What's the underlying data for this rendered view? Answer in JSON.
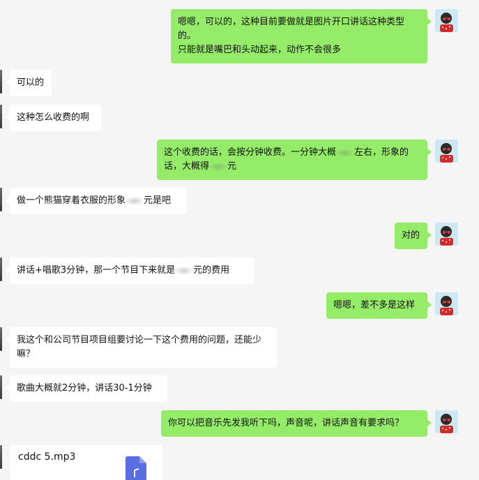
{
  "messages": [
    {
      "side": "out",
      "lines": [
        "嗯嗯，可以的，这种目前要做就是图片开口讲话这种类型的。",
        "只能就是嘴巴和头动起来，动作不会很多"
      ]
    },
    {
      "side": "in",
      "text": "可以的"
    },
    {
      "side": "in",
      "text": "这种怎么收费的啊"
    },
    {
      "side": "out",
      "text_parts": [
        "这个收费的话，会按分钟收费。一分钟大概",
        "左右，形象的话，大概得",
        "元"
      ]
    },
    {
      "side": "in",
      "text_parts": [
        "做一个熊猫穿着衣服的形象",
        "元是吧"
      ]
    },
    {
      "side": "out",
      "text": "对的"
    },
    {
      "side": "in",
      "text_parts": [
        "讲话+唱歌3分钟，那一个节目下来就是",
        "元的费用"
      ]
    },
    {
      "side": "out",
      "text": "嗯嗯，差不多是这样"
    },
    {
      "side": "in",
      "text": "我这个和公司节目项目组要讨论一下这个费用的问题，还能少嘛？"
    },
    {
      "side": "in",
      "text": "歌曲大概就2分钟，讲话30-1分钟"
    },
    {
      "side": "out",
      "text": "你可以把音乐先发我听下吗，声音呢，讲话声音有要求吗？"
    }
  ],
  "file": {
    "name": "cddc 5.mp3",
    "icon": "audio-file-icon"
  },
  "colors": {
    "out_bubble": "#95ec69",
    "in_bubble": "#ffffff",
    "background": "#f5f5f5",
    "file_icon": "#5b6ee1"
  }
}
